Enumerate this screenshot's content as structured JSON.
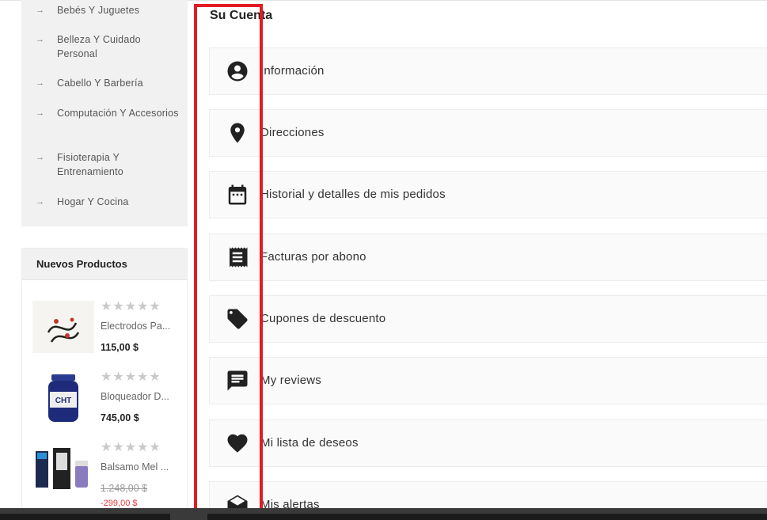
{
  "sidebar": {
    "categories": [
      {
        "arrow": "→",
        "label": "Bebés Y Juguetes"
      },
      {
        "arrow": "→",
        "label": "Belleza Y Cuidado Personal"
      },
      {
        "arrow": "→",
        "label": "Cabello Y Barbería"
      },
      {
        "arrow": "→",
        "label": "Computación Y Accesorios"
      },
      {
        "arrow": "→",
        "label": "Fisioterapia Y Entrenamiento"
      },
      {
        "arrow": "→",
        "label": "Hogar Y Cocina"
      }
    ]
  },
  "new_products": {
    "title": "Nuevos Productos",
    "items": [
      {
        "stars": "★★★★★",
        "name": "Electrodos Pa...",
        "price": "115,00 $",
        "rating": 0
      },
      {
        "stars": "★★★★★",
        "name": "Bloqueador D...",
        "price": "745,00 $",
        "rating": 0
      },
      {
        "stars": "★★★★★",
        "name": "Balsamo Mel ...",
        "old_price": "1.248,00 $",
        "price": "-299,00 $",
        "rating": 0
      }
    ]
  },
  "account": {
    "title": "Su Cuenta",
    "items": [
      {
        "icon": "user-circle-icon",
        "label": "Información"
      },
      {
        "icon": "location-pin-icon",
        "label": "Direcciones"
      },
      {
        "icon": "calendar-icon",
        "label": "Historial y detalles de mis pedidos"
      },
      {
        "icon": "receipt-icon",
        "label": "Facturas por abono"
      },
      {
        "icon": "tag-icon",
        "label": "Cupones de descuento"
      },
      {
        "icon": "comment-icon",
        "label": "My reviews"
      },
      {
        "icon": "heart-icon",
        "label": "Mi lista de deseos"
      },
      {
        "icon": "envelope-open-icon",
        "label": "Mis alertas"
      }
    ]
  },
  "colors": {
    "highlight": "#e21b24",
    "price_discount": "#e63939"
  }
}
